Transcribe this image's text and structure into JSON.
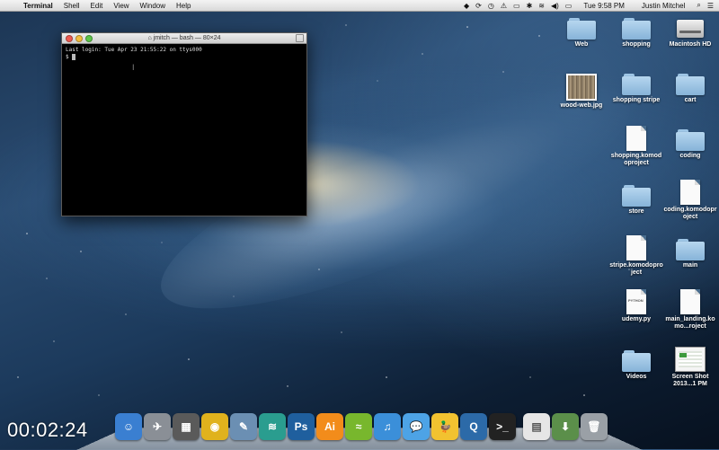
{
  "menubar": {
    "app_name": "Terminal",
    "menus": [
      "Shell",
      "Edit",
      "View",
      "Window",
      "Help"
    ],
    "clock": "Tue 9:58 PM",
    "user": "Justin Mitchel"
  },
  "terminal": {
    "title": "jmitch — bash — 80×24",
    "lines": [
      "Last login: Tue Apr 23 21:55:22 on ttys000",
      "$ "
    ]
  },
  "desktop_icons": [
    {
      "label": "Web",
      "kind": "folder"
    },
    {
      "label": "shopping",
      "kind": "folder"
    },
    {
      "label": "Macintosh HD",
      "kind": "drive"
    },
    {
      "label": "wood-web.jpg",
      "kind": "image"
    },
    {
      "label": "shopping stripe",
      "kind": "folder"
    },
    {
      "label": "cart",
      "kind": "folder"
    },
    {
      "label": "shopping.komodoproject",
      "kind": "document"
    },
    {
      "label": "coding",
      "kind": "folder"
    },
    {
      "label": "store",
      "kind": "folder"
    },
    {
      "label": "coding.komodoproject",
      "kind": "document"
    },
    {
      "label": "stripe.komodoproject",
      "kind": "document"
    },
    {
      "label": "main",
      "kind": "folder"
    },
    {
      "label": "udemy.py",
      "kind": "python-document",
      "badge": "PYTHON"
    },
    {
      "label": "main_landing.komo...roject",
      "kind": "document"
    },
    {
      "label": "Videos",
      "kind": "folder"
    },
    {
      "label": "Screen Shot 2013...1 PM",
      "kind": "screenshot"
    }
  ],
  "timer": "00:02:24",
  "dock": [
    {
      "name": "finder-icon",
      "color": "#3a7fd1",
      "glyph": "☺"
    },
    {
      "name": "launchpad-icon",
      "color": "#8a8f96",
      "glyph": "✈"
    },
    {
      "name": "dashboard-icon",
      "color": "#5a5a5a",
      "glyph": "▦"
    },
    {
      "name": "chrome-icon",
      "color": "#e0b21d",
      "glyph": "◉"
    },
    {
      "name": "preview-icon",
      "color": "#6b8fb3",
      "glyph": "✎"
    },
    {
      "name": "dreamweaver-icon",
      "color": "#2a9d8f",
      "glyph": "≋"
    },
    {
      "name": "photoshop-icon",
      "color": "#1f5f9e",
      "glyph": "Ps"
    },
    {
      "name": "illustrator-icon",
      "color": "#f28c1b",
      "glyph": "Ai"
    },
    {
      "name": "spotify-icon",
      "color": "#78b72d",
      "glyph": "≈"
    },
    {
      "name": "itunes-icon",
      "color": "#3b8fd9",
      "glyph": "♫"
    },
    {
      "name": "messages-icon",
      "color": "#4da3e6",
      "glyph": "💬"
    },
    {
      "name": "cyberduck-icon",
      "color": "#f2c230",
      "glyph": "🦆"
    },
    {
      "name": "quicktime-icon",
      "color": "#2c6aa8",
      "glyph": "Q"
    },
    {
      "name": "terminal-icon",
      "color": "#222222",
      "glyph": ">_"
    },
    {
      "name": "documents-stack-icon",
      "color": "#e6e6e6",
      "glyph": "▤"
    },
    {
      "name": "downloads-stack-icon",
      "color": "#5b8f4a",
      "glyph": "⬇"
    },
    {
      "name": "trash-icon",
      "color": "#9aa0a6",
      "glyph": "🗑"
    }
  ]
}
